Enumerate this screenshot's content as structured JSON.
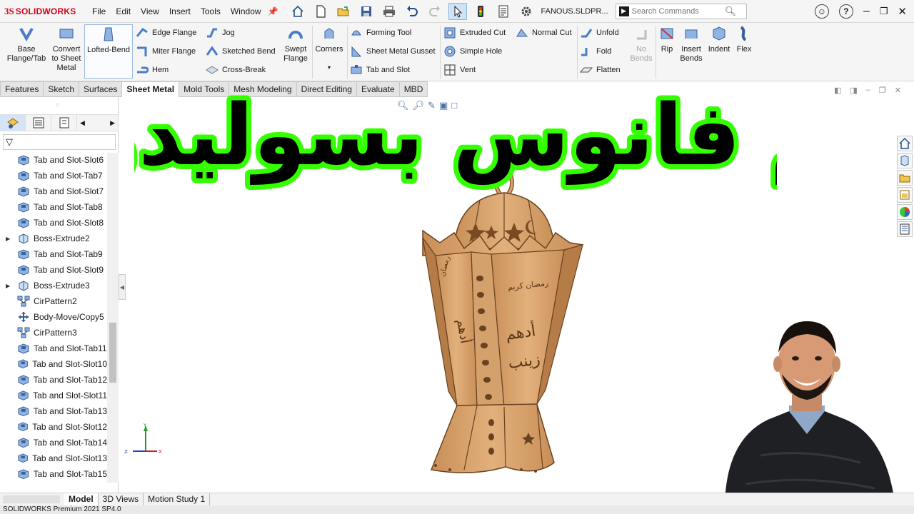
{
  "app": {
    "logo_mark": "3S",
    "logo_text": "SOLIDWORKS"
  },
  "menu": [
    "File",
    "Edit",
    "View",
    "Insert",
    "Tools",
    "Window"
  ],
  "document": {
    "name": "FANOUS.SLDPR..."
  },
  "search": {
    "placeholder": "Search Commands"
  },
  "ribbon": {
    "base_flange": "Base\nFlange/Tab",
    "convert": "Convert\nto Sheet\nMetal",
    "lofted_bend": "Lofted-Bend",
    "edge_flange": "Edge Flange",
    "miter_flange": "Miter Flange",
    "hem": "Hem",
    "jog": "Jog",
    "sketched_bend": "Sketched Bend",
    "cross_break": "Cross-Break",
    "swept_flange": "Swept\nFlange",
    "corners": "Corners",
    "forming_tool": "Forming Tool",
    "sheet_metal_gusset": "Sheet Metal Gusset",
    "tab_and_slot": "Tab and Slot",
    "extruded_cut": "Extruded Cut",
    "simple_hole": "Simple Hole",
    "vent": "Vent",
    "normal_cut": "Normal Cut",
    "unfold": "Unfold",
    "fold": "Fold",
    "flatten": "Flatten",
    "no_bends": "No\nBends",
    "rip": "Rip",
    "insert_bends": "Insert\nBends",
    "indent": "Indent",
    "flex": "Flex"
  },
  "tabs": [
    "Features",
    "Sketch",
    "Surfaces",
    "Sheet Metal",
    "Mold Tools",
    "Mesh Modeling",
    "Direct Editing",
    "Evaluate",
    "MBD"
  ],
  "active_tab": "Sheet Metal",
  "tree": [
    {
      "label": "Tab and Slot-Slot6",
      "icon": "tab-slot-icon",
      "expandable": false
    },
    {
      "label": "Tab and Slot-Tab7",
      "icon": "tab-slot-icon",
      "expandable": false
    },
    {
      "label": "Tab and Slot-Slot7",
      "icon": "tab-slot-icon",
      "expandable": false
    },
    {
      "label": "Tab and Slot-Tab8",
      "icon": "tab-slot-icon",
      "expandable": false
    },
    {
      "label": "Tab and Slot-Slot8",
      "icon": "tab-slot-icon",
      "expandable": false
    },
    {
      "label": "Boss-Extrude2",
      "icon": "boss-extrude-icon",
      "expandable": true
    },
    {
      "label": "Tab and Slot-Tab9",
      "icon": "tab-slot-icon",
      "expandable": false
    },
    {
      "label": "Tab and Slot-Slot9",
      "icon": "tab-slot-icon",
      "expandable": false
    },
    {
      "label": "Boss-Extrude3",
      "icon": "boss-extrude-icon",
      "expandable": true
    },
    {
      "label": "CirPattern2",
      "icon": "pattern-icon",
      "expandable": false
    },
    {
      "label": "Body-Move/Copy5",
      "icon": "move-copy-icon",
      "expandable": false
    },
    {
      "label": "CirPattern3",
      "icon": "pattern-icon",
      "expandable": false
    },
    {
      "label": "Tab and Slot-Tab11",
      "icon": "tab-slot-icon",
      "expandable": false
    },
    {
      "label": "Tab and Slot-Slot10",
      "icon": "tab-slot-icon",
      "expandable": false
    },
    {
      "label": "Tab and Slot-Tab12",
      "icon": "tab-slot-icon",
      "expandable": false
    },
    {
      "label": "Tab and Slot-Slot11",
      "icon": "tab-slot-icon",
      "expandable": false
    },
    {
      "label": "Tab and Slot-Tab13",
      "icon": "tab-slot-icon",
      "expandable": false
    },
    {
      "label": "Tab and Slot-Slot12",
      "icon": "tab-slot-icon",
      "expandable": false
    },
    {
      "label": "Tab and Slot-Tab14",
      "icon": "tab-slot-icon",
      "expandable": false
    },
    {
      "label": "Tab and Slot-Slot13",
      "icon": "tab-slot-icon",
      "expandable": false
    },
    {
      "label": "Tab and Slot-Tab15",
      "icon": "tab-slot-icon",
      "expandable": false
    }
  ],
  "bottom_tabs": [
    "Model",
    "3D Views",
    "Motion Study 1"
  ],
  "active_bottom_tab": "Model",
  "status": "SOLIDWORKS Premium 2021 SP4.0",
  "overlay": {
    "title": "تصميم فانوس بسوليدوركس",
    "text_color": "#000000",
    "outline_color": "#33ff00"
  },
  "triad": {
    "x": "X",
    "y": "Y",
    "z": "Z"
  },
  "colors": {
    "brand": "#d0021b",
    "wood": "#d9a672",
    "wood_dark": "#a9713d"
  }
}
